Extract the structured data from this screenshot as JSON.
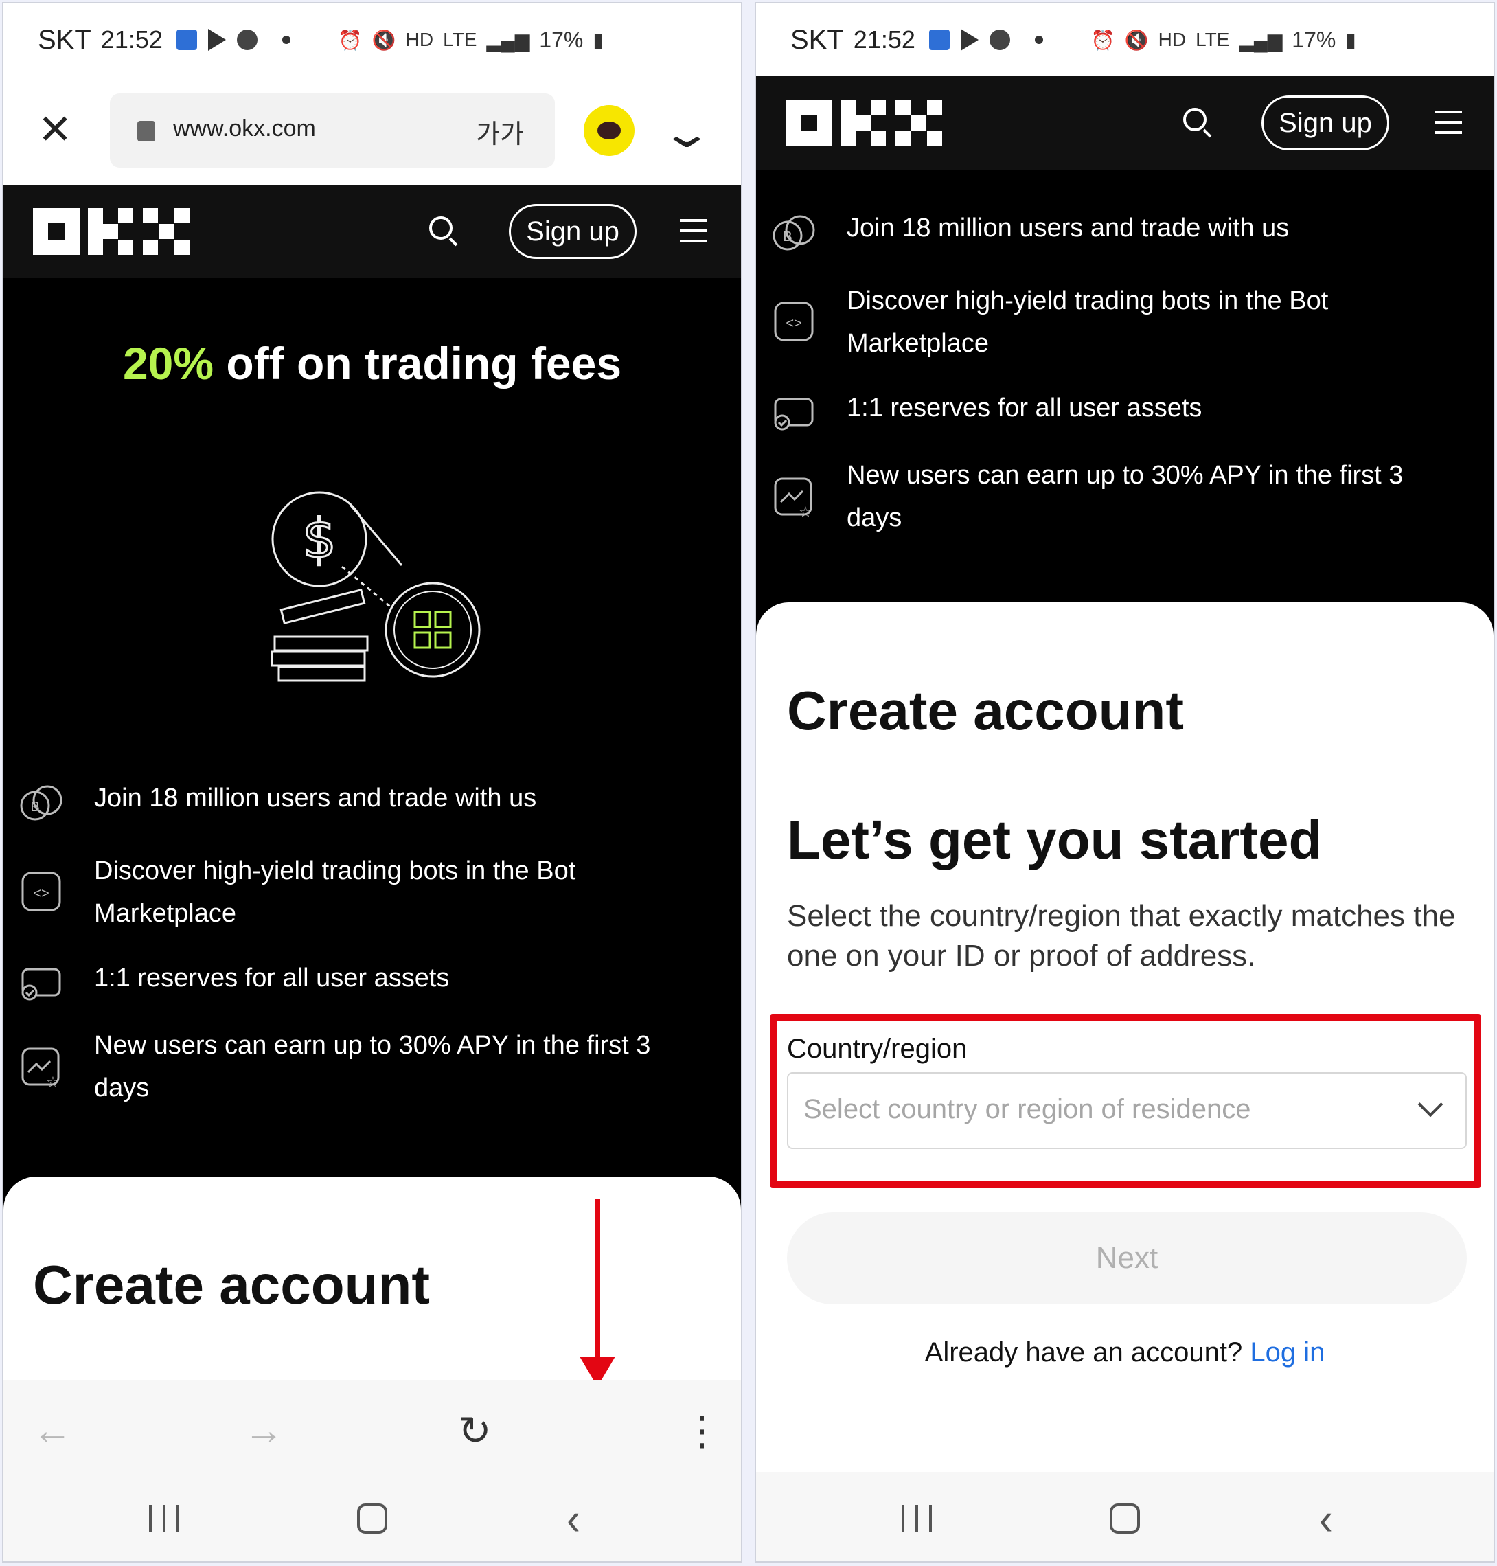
{
  "status_bar": {
    "carrier": "SKT",
    "time": "21:52",
    "battery": "17%",
    "icons": [
      "notification-icon",
      "play-icon",
      "wear-icon",
      "dot-icon",
      "alarm-icon",
      "mute-icon",
      "hd-voice-icon",
      "lte-icon",
      "signal-icon",
      "battery-icon"
    ],
    "hd_label": "HD",
    "lte_label": "LTE"
  },
  "browser": {
    "url": "www.okx.com",
    "text_size_label": "가가",
    "toolbar_icons": [
      "back-arrow-icon",
      "forward-arrow-icon",
      "reload-icon",
      "more-vert-icon"
    ]
  },
  "okx_header": {
    "signup_label": "Sign up"
  },
  "promo": {
    "highlight": "20%",
    "title_rest": " off on trading fees"
  },
  "features": [
    {
      "icon": "coins-icon",
      "text": "Join 18 million users and trade with us"
    },
    {
      "icon": "code-bot-icon",
      "text": "Discover high-yield trading bots in the Bot Marketplace"
    },
    {
      "icon": "wallet-check-icon",
      "text": "1:1 reserves for all user assets"
    },
    {
      "icon": "chart-star-icon",
      "text": "New users can earn up to 30% APY in the first 3 days"
    }
  ],
  "signup_form": {
    "title": "Create account",
    "subtitle": "Let’s get you started",
    "description": "Select the country/region that exactly matches the one on your ID or proof of address.",
    "field_label": "Country/region",
    "field_placeholder": "Select country or region of residence",
    "next_label": "Next",
    "login_prompt": "Already have an account?",
    "login_link": "Log in"
  },
  "colors": {
    "accent_green": "#b6f34e",
    "annotation_red": "#e30613",
    "link_blue": "#1f6ee0"
  }
}
